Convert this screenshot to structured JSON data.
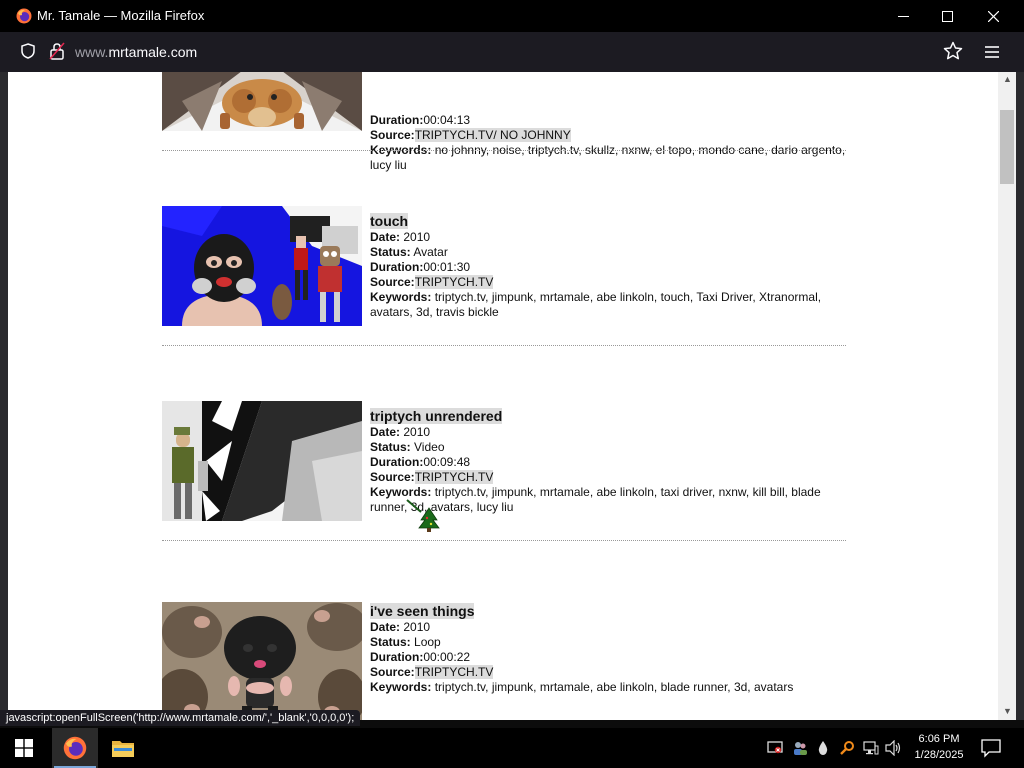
{
  "window": {
    "title": "Mr. Tamale — Mozilla Firefox",
    "url_prefix": "www.",
    "url_domain": "mrtamale.com"
  },
  "entries": [
    {
      "title": "",
      "date": "",
      "status": "",
      "duration": "00:04:13",
      "source": "TRIPTYCH.TV/ NO JOHNNY",
      "keywords": "no johnny, noise, triptych.tv, skullz, nxnw, el topo, mondo cane, dario argento, lucy liu"
    },
    {
      "title": "touch",
      "date": "2010",
      "status": "Avatar",
      "duration": "00:01:30",
      "source": "TRIPTYCH.TV",
      "keywords": "triptych.tv, jimpunk, mrtamale, abe linkoln, touch, Taxi Driver, Xtranormal, avatars, 3d, travis bickle"
    },
    {
      "title": "triptych unrendered",
      "date": "2010",
      "status": "Video",
      "duration": "00:09:48",
      "source": "TRIPTYCH.TV",
      "keywords": "triptych.tv, jimpunk, mrtamale, abe linkoln, taxi driver, nxnw, kill bill, blade runner, 3d, avatars, lucy liu"
    },
    {
      "title": "i've seen things",
      "date": "2010",
      "status": "Loop",
      "duration": "00:00:22",
      "source": "TRIPTYCH.TV",
      "keywords": "triptych.tv, jimpunk, mrtamale, abe linkoln, blade runner, 3d, avatars"
    }
  ],
  "labels": {
    "date": "Date:",
    "status": "Status:",
    "duration": "Duration:",
    "source": "Source:",
    "keywords": "Keywords:"
  },
  "status_bar": "javascript:openFullScreen('http://www.mrtamale.com/','_blank','0,0,0,0');",
  "taskbar": {
    "time": "6:06 PM",
    "date": "1/28/2025"
  },
  "icons": {
    "browser": "firefox-icon",
    "shield": "shield-icon",
    "lock": "lock-icon",
    "bookmark": "star-icon",
    "menu": "hamburger-menu-icon",
    "start": "windows-logo-icon",
    "explorer": "folder-icon",
    "cursor": "christmas-tree-cursor-icon"
  },
  "colors": {
    "title_highlight": "#dcdcdc",
    "navbar": "#1c1b22",
    "taskbar": "#000000"
  }
}
